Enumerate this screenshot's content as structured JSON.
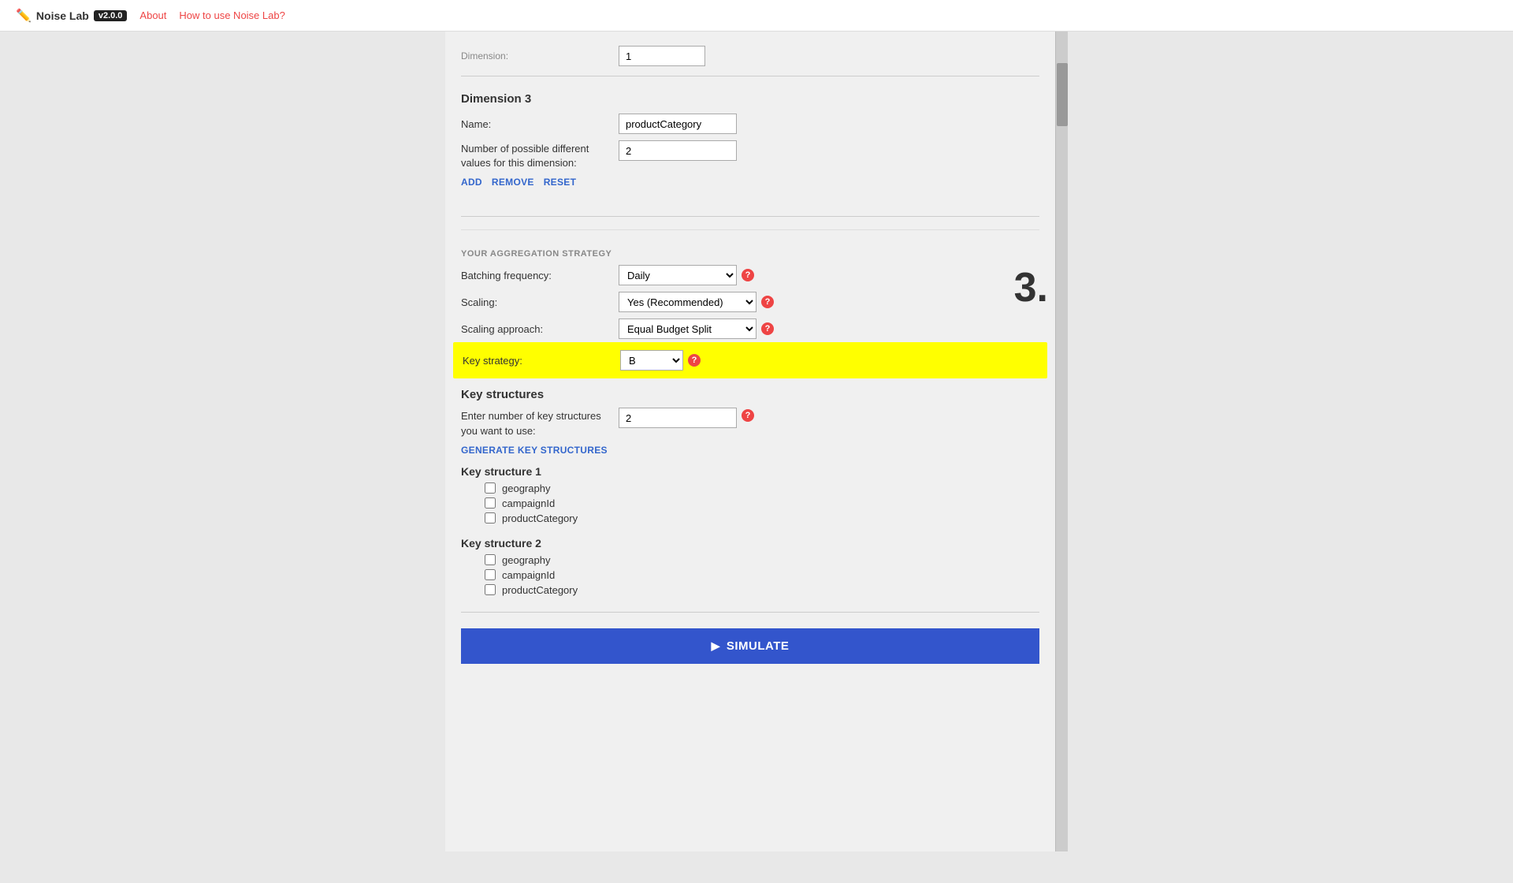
{
  "navbar": {
    "logo_text": "Noise Lab",
    "version": "v2.0.0",
    "links": [
      "About",
      "How to use Noise Lab?"
    ]
  },
  "dimension3": {
    "title": "Dimension 3",
    "name_label": "Name:",
    "name_value": "productCategory",
    "num_values_label": "Number of possible different values for this dimension:",
    "num_values": "2",
    "actions": {
      "add": "ADD",
      "remove": "REMOVE",
      "reset": "RESET"
    }
  },
  "aggregation": {
    "section_label": "YOUR AGGREGATION STRATEGY",
    "batching_label": "Batching frequency:",
    "batching_value": "Daily",
    "scaling_label": "Scaling:",
    "scaling_value": "Yes (Recommended)",
    "scaling_approach_label": "Scaling approach:",
    "scaling_approach_value": "Equal Budget Split",
    "key_strategy_label": "Key strategy:",
    "key_strategy_value": "B"
  },
  "key_structures": {
    "section_title": "Key structures",
    "enter_label": "Enter number of key structures you want to use:",
    "num_structures": "2",
    "generate_link": "GENERATE KEY STRUCTURES",
    "structures": [
      {
        "title": "Key structure 1",
        "items": [
          "geography",
          "campaignId",
          "productCategory"
        ],
        "checked": [
          false,
          false,
          false
        ]
      },
      {
        "title": "Key structure 2",
        "items": [
          "geography",
          "campaignId",
          "productCategory"
        ],
        "checked": [
          false,
          false,
          false
        ]
      }
    ]
  },
  "simulate": {
    "button_label": "SIMULATE"
  },
  "annotation": "3.",
  "top_partial": {
    "label": "Dimension:",
    "value": "1"
  }
}
